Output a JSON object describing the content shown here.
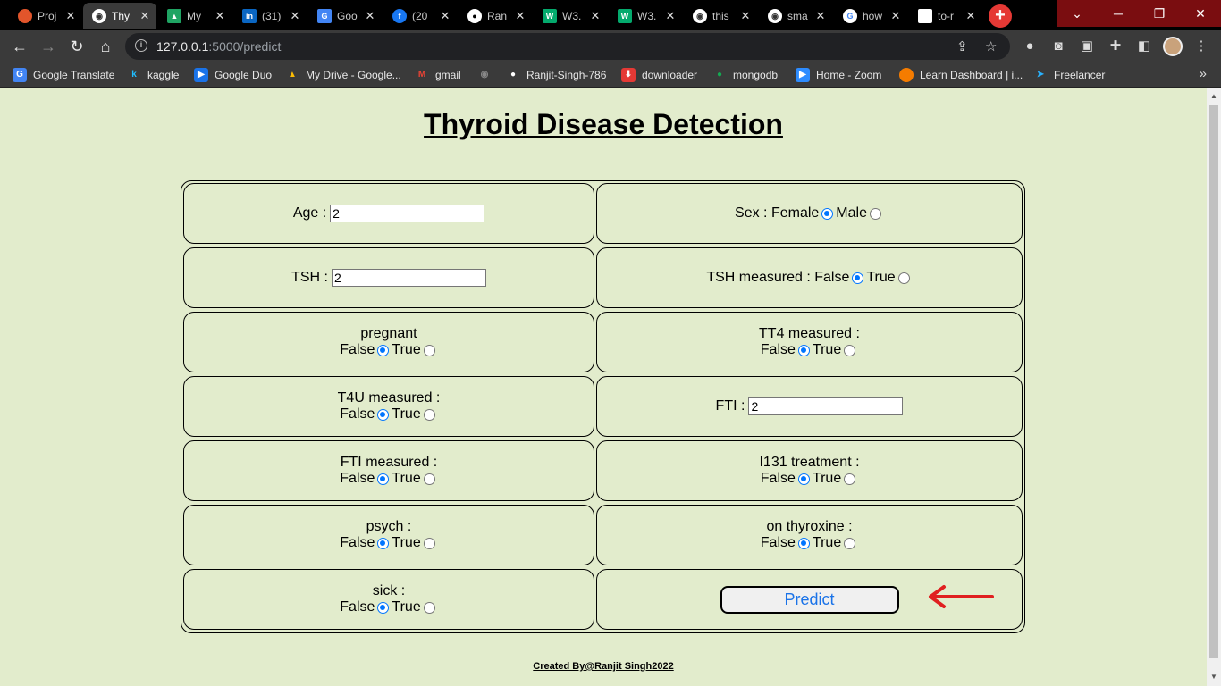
{
  "browser": {
    "tabs": [
      {
        "label": "Proj",
        "favicon_color": "#e2552b",
        "active": false
      },
      {
        "label": "Thy",
        "favicon_color": "#ffffff",
        "active": true
      },
      {
        "label": "My",
        "favicon_color": "#1fa463",
        "active": false
      },
      {
        "label": "(31)",
        "favicon_color": "#0a66c2",
        "active": false
      },
      {
        "label": "Goo",
        "favicon_color": "#4285f4",
        "active": false
      },
      {
        "label": "(20",
        "favicon_color": "#1877f2",
        "active": false
      },
      {
        "label": "Ran",
        "favicon_color": "#ffffff",
        "active": false
      },
      {
        "label": "W3.",
        "favicon_color": "#04aa6d",
        "active": false
      },
      {
        "label": "W3.",
        "favicon_color": "#04aa6d",
        "active": false
      },
      {
        "label": "this",
        "favicon_color": "#ffffff",
        "active": false
      },
      {
        "label": "sma",
        "favicon_color": "#ffffff",
        "active": false
      },
      {
        "label": "how",
        "favicon_color": "#4285f4",
        "active": false
      },
      {
        "label": "to-r",
        "favicon_color": "#ffffff",
        "active": false
      }
    ],
    "new_tab_label": "+",
    "address": {
      "host": "127.0.0.1",
      "path": ":5000/predict"
    },
    "bookmarks": [
      {
        "label": "Google Translate",
        "icon": "translate-icon",
        "color": "#4285f4"
      },
      {
        "label": "kaggle",
        "icon": "kaggle-icon",
        "color": "#20beff"
      },
      {
        "label": "Google Duo",
        "icon": "duo-icon",
        "color": "#1a73e8"
      },
      {
        "label": "My Drive - Google...",
        "icon": "drive-icon",
        "color": "#fbbc04"
      },
      {
        "label": "gmail",
        "icon": "gmail-icon",
        "color": "#ea4335"
      },
      {
        "label": "",
        "icon": "globe-icon",
        "color": "#888888"
      },
      {
        "label": "Ranjit-Singh-786",
        "icon": "github-icon",
        "color": "#ffffff"
      },
      {
        "label": "downloader",
        "icon": "downloader-icon",
        "color": "#e53935"
      },
      {
        "label": "mongodb",
        "icon": "mongodb-icon",
        "color": "#13aa52"
      },
      {
        "label": "Home - Zoom",
        "icon": "zoom-icon",
        "color": "#2d8cff"
      },
      {
        "label": "Learn Dashboard | i...",
        "icon": "learn-icon",
        "color": "#f57c00"
      },
      {
        "label": "Freelancer",
        "icon": "freelancer-icon",
        "color": "#29b2fe"
      }
    ]
  },
  "page": {
    "title": "Thyroid Disease Detection",
    "fields": {
      "age": {
        "label": "Age :",
        "value": "2"
      },
      "sex": {
        "label": "Sex :",
        "opt1": "Female",
        "opt2": "Male"
      },
      "tsh": {
        "label": "TSH :",
        "value": "2"
      },
      "tsh_measured": {
        "label": "TSH measured :",
        "opt1": "False",
        "opt2": "True"
      },
      "pregnant": {
        "label": "pregnant",
        "opt1": "False",
        "opt2": "True"
      },
      "tt4_measured": {
        "label": "TT4 measured :",
        "opt1": "False",
        "opt2": "True"
      },
      "t4u_measured": {
        "label": "T4U measured :",
        "opt1": "False",
        "opt2": "True"
      },
      "fti": {
        "label": "FTI :",
        "value": "2"
      },
      "fti_measured": {
        "label": "FTI measured :",
        "opt1": "False",
        "opt2": "True"
      },
      "i131_treatment": {
        "label": "I131 treatment :",
        "opt1": "False",
        "opt2": "True"
      },
      "psych": {
        "label": "psych :",
        "opt1": "False",
        "opt2": "True"
      },
      "on_thyroxine": {
        "label": "on thyroxine :",
        "opt1": "False",
        "opt2": "True"
      },
      "sick": {
        "label": "sick :",
        "opt1": "False",
        "opt2": "True"
      }
    },
    "predict_label": "Predict",
    "footer": "Created By@Ranjit Singh2022"
  },
  "colors": {
    "page_bg": "#e2eccc",
    "radio_accent": "#0075ff",
    "button_text": "#1a73e8",
    "arrow": "#e02020"
  }
}
